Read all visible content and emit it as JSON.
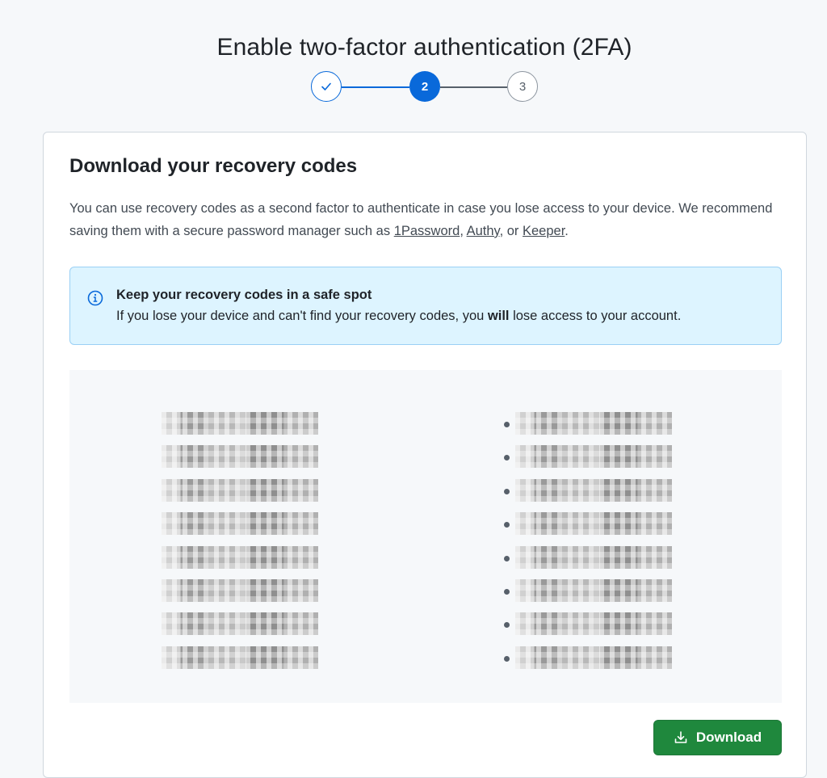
{
  "page": {
    "title": "Enable two-factor authentication (2FA)"
  },
  "stepper": {
    "steps": [
      {
        "label": "",
        "state": "complete",
        "icon": "check-icon"
      },
      {
        "label": "2",
        "state": "current"
      },
      {
        "label": "3",
        "state": "upcoming"
      }
    ]
  },
  "card": {
    "heading": "Download your recovery codes",
    "description": {
      "part1": "You can use recovery codes as a second factor to authenticate in case you lose access to your device. We recommend saving them with a secure password manager such as ",
      "link1": "1Password",
      "sep1": ", ",
      "link2": "Authy",
      "sep2": ", or ",
      "link3": "Keeper",
      "end": "."
    },
    "flash": {
      "icon": "info-icon",
      "title": "Keep your recovery codes in a safe spot",
      "body_part1": "If you lose your device and can't find your recovery codes, you ",
      "body_bold": "will",
      "body_part2": " lose access to your account."
    },
    "codes_left": [
      "",
      "",
      "",
      "",
      "",
      "",
      "",
      ""
    ],
    "codes_right": [
      "",
      "",
      "",
      "",
      "",
      "",
      "",
      ""
    ],
    "download_button": {
      "label": "Download",
      "icon": "download-icon"
    }
  },
  "colors": {
    "accent": "#0969da",
    "success": "#1f883d",
    "flash_bg": "#ddf4ff"
  }
}
